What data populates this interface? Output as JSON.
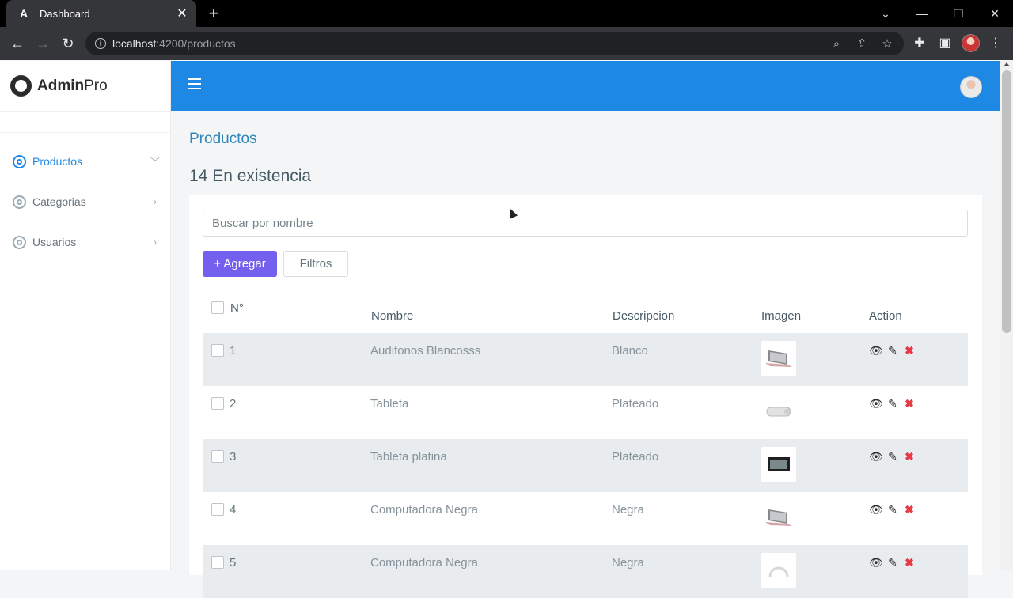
{
  "browser": {
    "tab_title": "Dashboard",
    "tab_favicon": "A",
    "url_host": "localhost",
    "url_path": ":4200/productos"
  },
  "sidebar": {
    "brand_bold": "Admin",
    "brand_light": "Pro",
    "items": [
      {
        "label": "Productos",
        "icon": "target-icon",
        "chevron": "chevron-down-icon",
        "active": true
      },
      {
        "label": "Categorias",
        "icon": "target-icon",
        "chevron": "chevron-right-icon",
        "active": false
      },
      {
        "label": "Usuarios",
        "icon": "target-icon",
        "chevron": "chevron-right-icon",
        "active": false
      }
    ]
  },
  "main": {
    "page_title": "Productos",
    "stock_title": "14 En existencia",
    "search_placeholder": "Buscar por nombre",
    "add_label": "+ Agregar",
    "filter_label": "Filtros"
  },
  "table": {
    "headers": {
      "number": "N°",
      "name": "Nombre",
      "description": "Descripcion",
      "image": "Imagen",
      "action": "Action"
    },
    "rows": [
      {
        "n": "1",
        "name": "Audifonos Blancosss",
        "desc": "Blanco",
        "image": "laptop"
      },
      {
        "n": "2",
        "name": "Tableta",
        "desc": "Plateado",
        "image": "speaker"
      },
      {
        "n": "3",
        "name": "Tableta platina",
        "desc": "Plateado",
        "image": "monitor"
      },
      {
        "n": "4",
        "name": "Computadora Negra",
        "desc": "Negra",
        "image": "laptop"
      },
      {
        "n": "5",
        "name": "Computadora Negra",
        "desc": "Negra",
        "image": "headphones"
      }
    ]
  },
  "colors": {
    "topbar": "#1e88e5",
    "add_button": "#7460ee",
    "delete_icon": "#e53945",
    "active_nav": "#1e88e5"
  }
}
